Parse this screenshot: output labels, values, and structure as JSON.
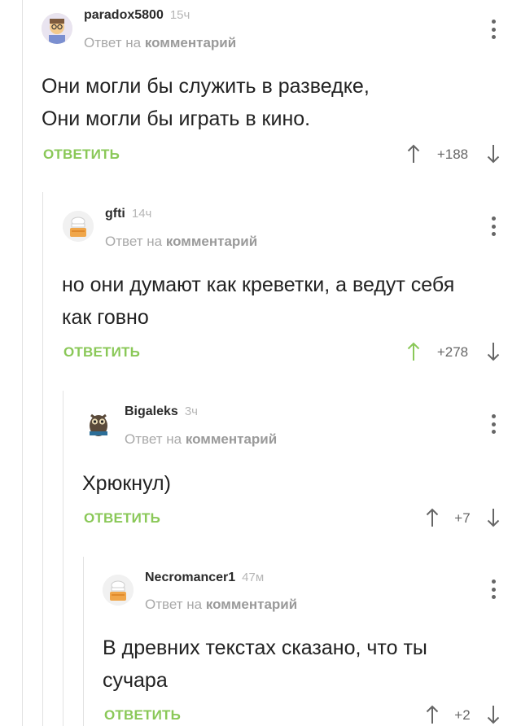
{
  "comments": [
    {
      "author": "paradox5800",
      "time": "15ч",
      "reply_prefix": "Ответ на",
      "reply_target": "комментарий",
      "lines": [
        "Они могли бы служить в разведке,",
        "Они могли бы играть в кино."
      ],
      "reply_label": "ОТВЕТИТЬ",
      "rating": "+188",
      "upvoted": false
    },
    {
      "author": "gfti",
      "time": "14ч",
      "reply_prefix": "Ответ на",
      "reply_target": "комментарий",
      "lines": [
        "но они думают как креветки, а ведут себя",
        "как говно"
      ],
      "reply_label": "ОТВЕТИТЬ",
      "rating": "+278",
      "upvoted": true
    },
    {
      "author": "Bigaleks",
      "time": "3ч",
      "reply_prefix": "Ответ на",
      "reply_target": "комментарий",
      "lines": [
        "Хрюкнул)"
      ],
      "reply_label": "ОТВЕТИТЬ",
      "rating": "+7",
      "upvoted": false
    },
    {
      "author": "Necromancer1",
      "time": "47м",
      "reply_prefix": "Ответ на",
      "reply_target": "комментарий",
      "lines": [
        "В древних текстах сказано, что ты",
        "сучара"
      ],
      "reply_label": "ОТВЕТИТЬ",
      "rating": "+2",
      "upvoted": false
    }
  ],
  "colors": {
    "accent_green": "#8ac858",
    "meta_gray": "#a9a9a9",
    "text": "#222222",
    "thread_line": "#e2e2e2"
  },
  "icons": {
    "menu": "vertical-ellipsis",
    "upvote": "arrow-up",
    "downvote": "arrow-down"
  }
}
